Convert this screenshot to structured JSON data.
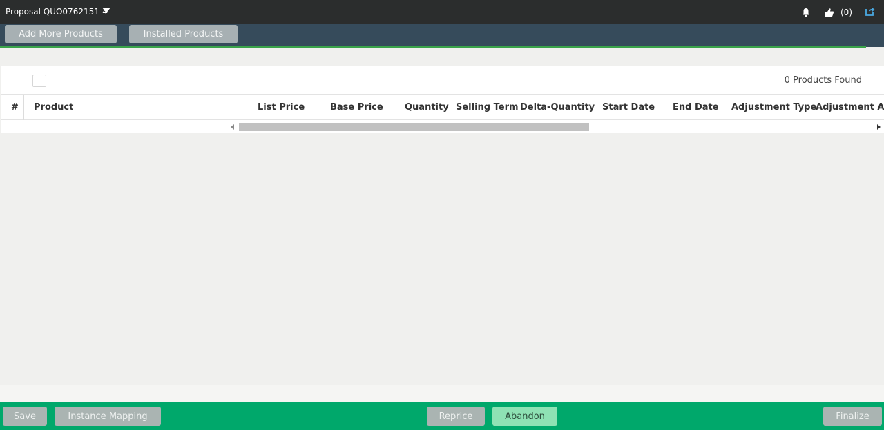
{
  "topbar": {
    "title": "Proposal QUO0762151-4",
    "like_count": "(0)",
    "icons": [
      "chevron-down-icon",
      "bell-icon",
      "thumbs-up-icon",
      "export-icon"
    ]
  },
  "toolbar": {
    "add_more_products": "Add More Products",
    "installed_products": "Installed Products"
  },
  "grid": {
    "found_text": "0 Products Found",
    "columns": {
      "hash": "#",
      "product": "Product",
      "list_price": "List Price",
      "base_price": "Base Price",
      "quantity": "Quantity",
      "selling_term": "Selling Term",
      "delta_quantity": "Delta-Quantity",
      "start_date": "Start Date",
      "end_date": "End Date",
      "adjustment_type": "Adjustment Type",
      "adjustment_amount": "Adjustment Amount"
    }
  },
  "footer": {
    "save": "Save",
    "instance_mapping": "Instance Mapping",
    "reprice": "Reprice",
    "abandon": "Abandon",
    "finalize": "Finalize"
  },
  "colors": {
    "topbar": "#2b2d2d",
    "subbar": "#364b5b",
    "accent_green": "#00a86b",
    "progress_line": "#3aa34a"
  }
}
